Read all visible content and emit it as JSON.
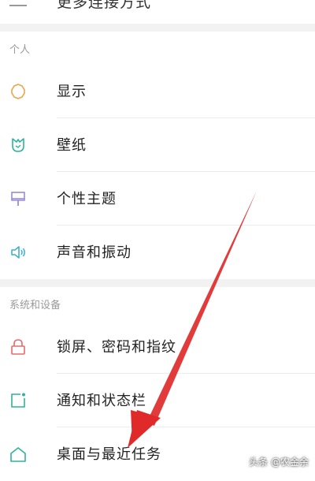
{
  "top_partial_item": {
    "label": "更多连接方式"
  },
  "sections": {
    "personal": {
      "header": "个人",
      "items": [
        {
          "label": "显示",
          "icon": "display-sun-icon",
          "color": "#e8a64a"
        },
        {
          "label": "壁纸",
          "icon": "wallpaper-tulip-icon",
          "color": "#2fb39a"
        },
        {
          "label": "个性主题",
          "icon": "theme-brush-icon",
          "color": "#9b8ad6"
        },
        {
          "label": "声音和振动",
          "icon": "sound-speaker-icon",
          "color": "#3fb0c8"
        }
      ]
    },
    "system": {
      "header": "系统和设备",
      "items": [
        {
          "label": "锁屏、密码和指纹",
          "icon": "lock-icon",
          "color": "#e56b6b"
        },
        {
          "label": "通知和状态栏",
          "icon": "notification-icon",
          "color": "#2fb39a"
        },
        {
          "label": "桌面与最近任务",
          "icon": "home-icon",
          "color": "#2fb39a"
        }
      ]
    }
  },
  "annotation": {
    "arrow_color": "#e02a2a"
  },
  "watermark": {
    "text": "头条 @农金余"
  }
}
